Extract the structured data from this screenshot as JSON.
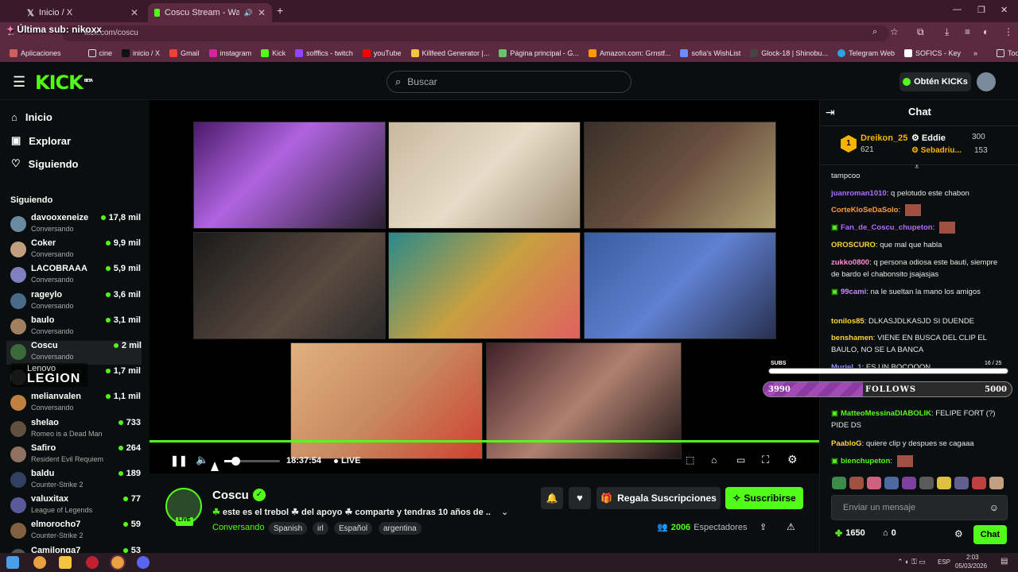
{
  "browser": {
    "tabs": [
      {
        "label": "Inicio / X"
      },
      {
        "label": "Coscu Stream - Watch Live"
      }
    ],
    "address": "kick.com/coscu",
    "overlay_text": "Última sub: nikoxx",
    "bookmarks": [
      "Aplicaciones",
      "cine",
      "inicio / X",
      "Gmail",
      "instagram",
      "Kick",
      "sofffics - twitch",
      "youTube",
      "Killfeed Generator |...",
      "Página principal - G...",
      "Amazon.com: Grnstf...",
      "sofia's WishList",
      "Glock-18 | Shinobu...",
      "Telegram Web",
      "SOFICS - Key"
    ],
    "bookmarks_all": "Todos los marcadores"
  },
  "header": {
    "logo": "KICK",
    "logo_beta": "BETA",
    "search_placeholder": "Buscar",
    "get_kicks": "Obtén KICKs"
  },
  "nav": {
    "inicio": "Inicio",
    "explorar": "Explorar",
    "siguiendo": "Siguiendo"
  },
  "following": {
    "title": "Siguiendo",
    "channels": [
      {
        "name": "davooxeneize",
        "category": "Conversando",
        "viewers": "17,8 mil"
      },
      {
        "name": "Coker",
        "category": "Conversando",
        "viewers": "9,9 mil"
      },
      {
        "name": "LACOBRAAA",
        "category": "Conversando",
        "viewers": "5,9 mil"
      },
      {
        "name": "rageylo",
        "category": "Conversando",
        "viewers": "3,6 mil"
      },
      {
        "name": "baulo",
        "category": "Conversando",
        "viewers": "3,1 mil"
      },
      {
        "name": "Coscu",
        "category": "Conversando",
        "viewers": "2 mil"
      },
      {
        "name": "",
        "category": "",
        "viewers": "1,7 mil"
      },
      {
        "name": "melianvalen",
        "category": "Conversando",
        "viewers": "1,1 mil"
      },
      {
        "name": "shelao",
        "category": "Romeo is a Dead Man",
        "viewers": "733"
      },
      {
        "name": "Safiro",
        "category": "Resident Evil Requiem",
        "viewers": "264"
      },
      {
        "name": "baldu",
        "category": "Counter-Strike 2",
        "viewers": "189"
      },
      {
        "name": "valuxitax",
        "category": "League of Legends",
        "viewers": "77"
      },
      {
        "name": "elmorocho7",
        "category": "Counter-Strike 2",
        "viewers": "59"
      },
      {
        "name": "Camilonga7",
        "category": "",
        "viewers": "53"
      }
    ]
  },
  "lenovo": {
    "top": "Lenovo",
    "bottom": "LEGION"
  },
  "player": {
    "time": "18:37:54",
    "live": "LIVE",
    "volume_fraction": 0.2
  },
  "stream": {
    "channel": "Coscu",
    "live_badge": "LIVE",
    "title": "este es el trebol ☘ del apoyo ☘ comparte y tendras 10 años de ...",
    "category": "Conversando",
    "tags": [
      "Spanish",
      "irl",
      "Español",
      "argentina"
    ],
    "viewers": "2006",
    "viewers_label": "Espectadores",
    "gift_label": "Regala Suscripciones",
    "subscribe_label": "Suscribirse"
  },
  "chat": {
    "title": "Chat",
    "leaderboard": [
      {
        "name": "Dreikon_25",
        "value": "621"
      },
      {
        "name": "Eddie",
        "value": "300"
      },
      {
        "name": "Sebadriu...",
        "value": "153"
      }
    ],
    "messages": [
      {
        "user": "",
        "text": "tampcoo",
        "color": "#e8e8e8"
      },
      {
        "user": "juanroman1010",
        "text": "q pelotudo este chabon",
        "color": "#b36bff"
      },
      {
        "user": "CorteKloSeDaSolo",
        "text": "",
        "color": "#ff9a3c"
      },
      {
        "user": "Fan_de_Coscu_chupeton",
        "text": "",
        "color": "#b36bff"
      },
      {
        "user": "OROSCURO",
        "text": "que mal que habla",
        "color": "#ffd23c"
      },
      {
        "user": "zukko0800",
        "text": "q persona odiosa este bauti, siempre de bardo el chabonsito jsajasjas",
        "color": "#ff8cd9"
      },
      {
        "user": "99cami",
        "text": "na le sueltan la mano los amigos",
        "color": "#c28cff"
      },
      {
        "user": "tonilos85",
        "text": "DLKASJDLKASJD SI DUENDE",
        "color": "#ffd23c"
      },
      {
        "user": "benshamen",
        "text": "VIENE EN BUSCA DEL CLIP EL BAULO, NO SE LA BANCA",
        "color": "#ffd23c"
      },
      {
        "user": "Muriel_1",
        "text": "ES UN BOCOOON",
        "color": "#8c8cff"
      },
      {
        "user": "MatteoMessinaDIABOLIK",
        "text": "FELIPE FORT (?) PIDE DS",
        "color": "#53fc18"
      },
      {
        "user": "PaabloG",
        "text": "quiere clip y despues se cagaaa",
        "color": "#ffd23c"
      },
      {
        "user": "bienchupeton",
        "text": "",
        "color": "#53fc18"
      }
    ],
    "input_placeholder": "Enviar un mensaje",
    "points": "1650",
    "other_points": "0",
    "send_label": "Chat"
  },
  "overlay": {
    "subs_label": "SUBS",
    "subs_progress": "16 / 25",
    "follows_left": "3990",
    "follows_label": "FOLLOWS",
    "follows_right": "5000",
    "follows_fraction": 0.4
  },
  "taskbar": {
    "lang": "ESP",
    "time": "2:03",
    "date": "05/03/2026"
  },
  "colors": {
    "accent": "#53fc18",
    "chrome": "#5b2a40"
  }
}
